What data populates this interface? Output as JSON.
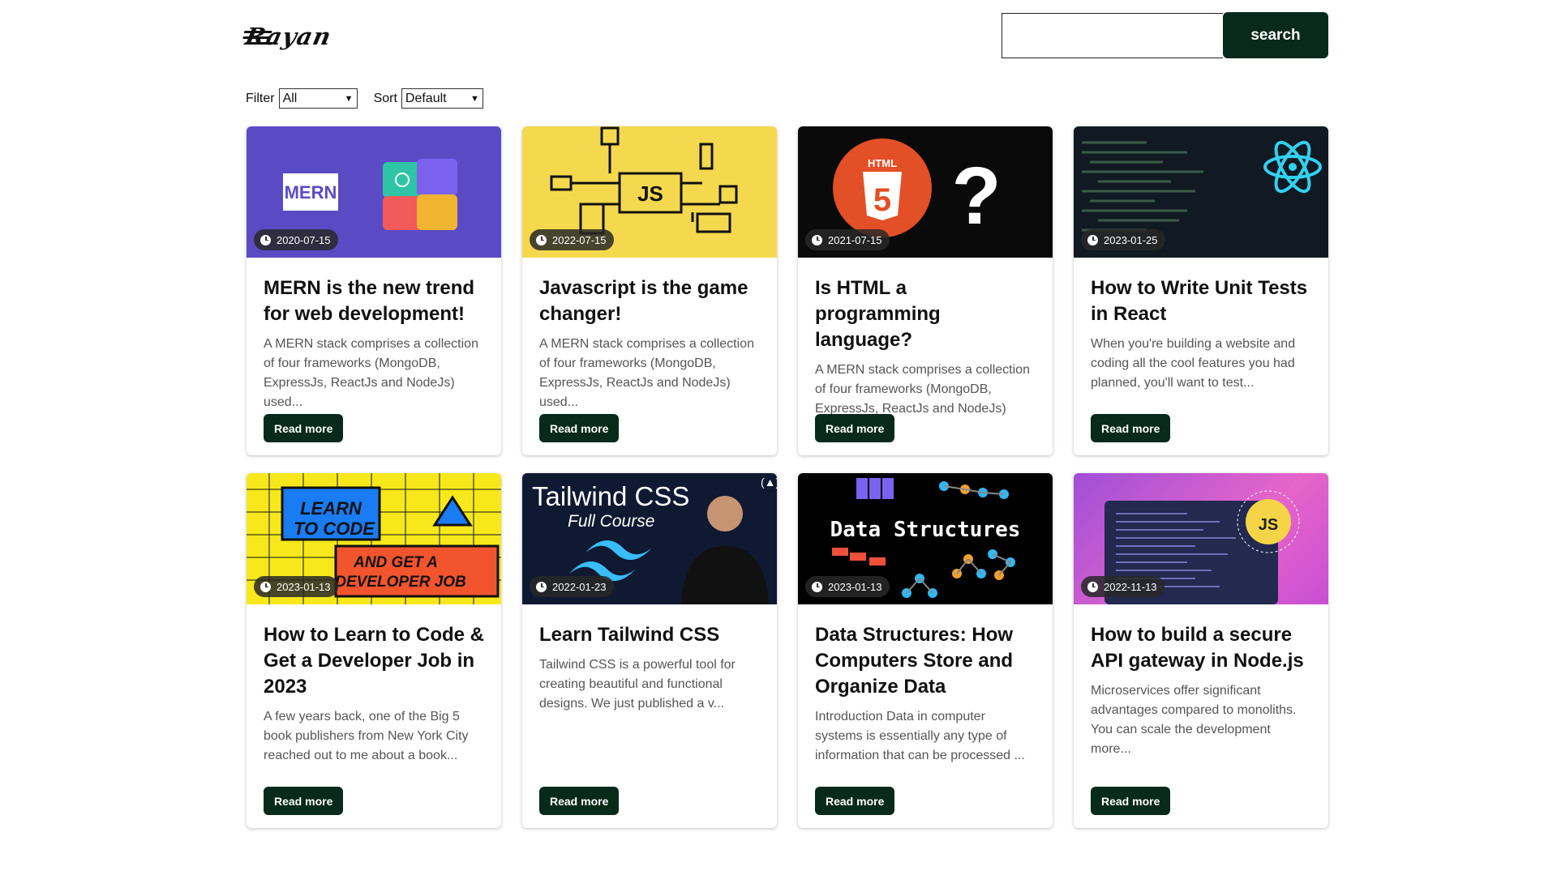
{
  "header": {
    "logo_text": "Rayan",
    "search_placeholder": "",
    "search_label": "search"
  },
  "controls": {
    "filter_label": "Filter",
    "filter_value": "All",
    "sort_label": "Sort",
    "sort_value": "Default"
  },
  "cards": [
    {
      "date": "2020-07-15",
      "title": "MERN is the new trend for web development!",
      "excerpt": "A MERN stack comprises a collection of four frameworks (MongoDB, ExpressJs, ReactJs and NodeJs) used...",
      "button": "Read more",
      "thumb_text": "MERN"
    },
    {
      "date": "2022-07-15",
      "title": "Javascript is the game changer!",
      "excerpt": "A MERN stack comprises a collection of four frameworks (MongoDB, ExpressJs, ReactJs and NodeJs) used...",
      "button": "Read more",
      "thumb_text": "JS"
    },
    {
      "date": "2021-07-15",
      "title": "Is HTML a programming language?",
      "excerpt": "A MERN stack comprises a collection of four frameworks (MongoDB, ExpressJs, ReactJs and NodeJs) used...",
      "button": "Read more",
      "thumb_text": "HTML"
    },
    {
      "date": "2023-01-25",
      "title": "How to Write Unit Tests in React",
      "excerpt": "When you're building a website and coding all the cool features you had planned, you'll want to test...",
      "button": "Read more",
      "thumb_text": ""
    },
    {
      "date": "2023-01-13",
      "title": "How to Learn to Code & Get a Developer Job in 2023",
      "excerpt": "A few years back, one of the Big 5 book publishers from New York City reached out to me about a book...",
      "button": "Read more",
      "thumb_text": "LEARN TO CODE AND GET A DEVELOPER JOB"
    },
    {
      "date": "2022-01-23",
      "title": "Learn Tailwind CSS",
      "excerpt": "Tailwind CSS is a powerful tool for creating beautiful and functional designs. We just published a v...",
      "button": "Read more",
      "thumb_text": "Tailwind CSS Full Course"
    },
    {
      "date": "2023-01-13",
      "title": "Data Structures: How Computers Store and Organize Data",
      "excerpt": "Introduction Data in computer systems is essentially any type of information that can be processed ...",
      "button": "Read more",
      "thumb_text": "Data Structures"
    },
    {
      "date": "2022-11-13",
      "title": "How to build a secure API gateway in Node.js",
      "excerpt": "Microservices offer significant advantages compared to monoliths. You can scale the development more...",
      "button": "Read more",
      "thumb_text": "JS"
    }
  ]
}
